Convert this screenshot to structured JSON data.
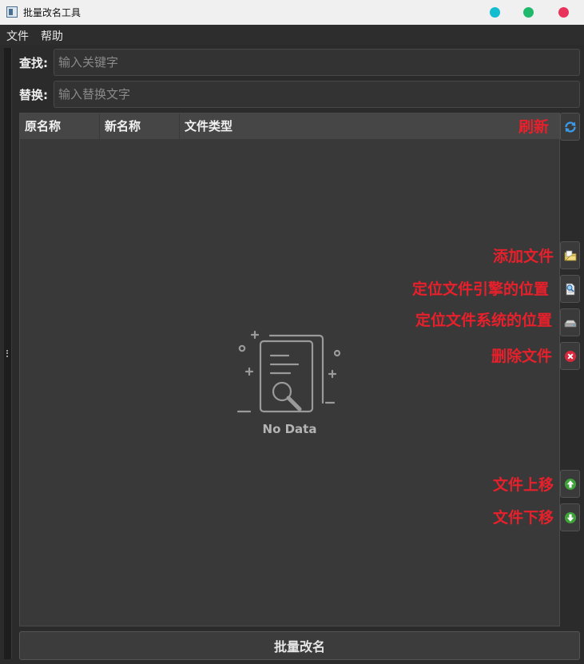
{
  "window": {
    "title": "批量改名工具"
  },
  "menu": {
    "items": [
      "文件",
      "帮助"
    ]
  },
  "search": {
    "label": "查找:",
    "placeholder": "输入关键字",
    "value": ""
  },
  "replace": {
    "label": "替换:",
    "placeholder": "输入替换文字",
    "value": ""
  },
  "table": {
    "columns": [
      "原名称",
      "新名称",
      "文件类型"
    ],
    "rows": [],
    "empty_text": "No Data"
  },
  "annotations": {
    "refresh": "刷新",
    "add_file": "添加文件",
    "locate_engine": "定位文件引擎的位置",
    "locate_system": "定位文件系统的位置",
    "delete_file": "删除文件",
    "move_up": "文件上移",
    "move_down": "文件下移"
  },
  "icons": {
    "refresh": "refresh-icon",
    "add_file": "folder-add-icon",
    "locate_engine": "document-search-icon",
    "locate_system": "disk-drive-icon",
    "delete_file": "delete-icon",
    "move_up": "arrow-up-icon",
    "move_down": "arrow-down-icon"
  },
  "actions": {
    "batch_rename": "批量改名"
  },
  "colors": {
    "annotation": "#e8202b",
    "background": "#2b2b2b",
    "traffic_cyan": "#14bcd0",
    "traffic_green": "#20b86a",
    "traffic_red": "#e8335a"
  }
}
